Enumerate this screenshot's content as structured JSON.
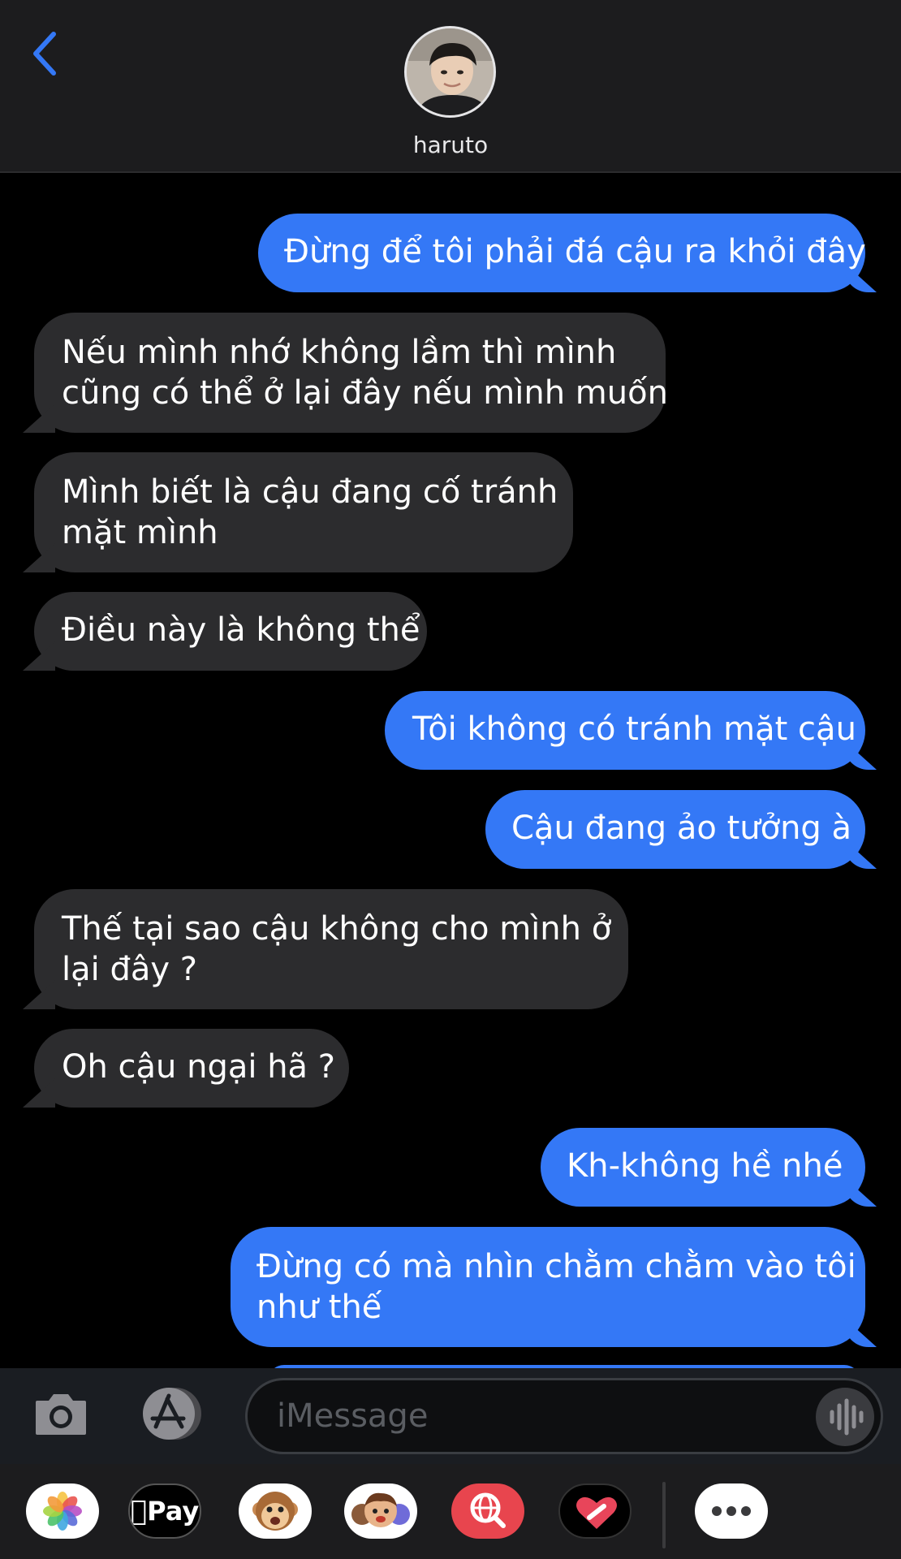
{
  "header": {
    "contact_name": "haruto",
    "back_label": "Back"
  },
  "messages": [
    {
      "direction": "out",
      "text": "Đừng để tôi phải đá cậu ra khỏi đây"
    },
    {
      "direction": "in",
      "text": "Nếu mình nhớ không lầm thì mình\ncũng có thể ở lại đây nếu mình muốn"
    },
    {
      "direction": "in",
      "text": "Mình biết là cậu đang cố tránh\nmặt mình"
    },
    {
      "direction": "in",
      "text": "Điều này là không thể"
    },
    {
      "direction": "out",
      "text": "Tôi không có tránh mặt cậu"
    },
    {
      "direction": "out",
      "text": "Cậu đang ảo tưởng à"
    },
    {
      "direction": "in",
      "text": "Thế tại sao cậu không cho mình ở\nlại đây ?"
    },
    {
      "direction": "in",
      "text": "Oh cậu ngại hã ?"
    },
    {
      "direction": "out",
      "text": "Kh-không hề nhé"
    },
    {
      "direction": "out",
      "text": "Đừng có mà nhìn chằm chằm vào tôi\nnhư thế"
    }
  ],
  "composer": {
    "placeholder": "iMessage"
  },
  "app_drawer": {
    "apps": [
      "photos-icon",
      "apple-pay-icon",
      "animoji-icon",
      "memoji-icon",
      "web-search-icon",
      "digital-touch-icon",
      "more-icon"
    ],
    "apple_pay_label": "Pay"
  },
  "colors": {
    "outgoing_bubble": "#3478f6",
    "incoming_bubble": "#2c2c2e",
    "accent": "#3478f6"
  }
}
